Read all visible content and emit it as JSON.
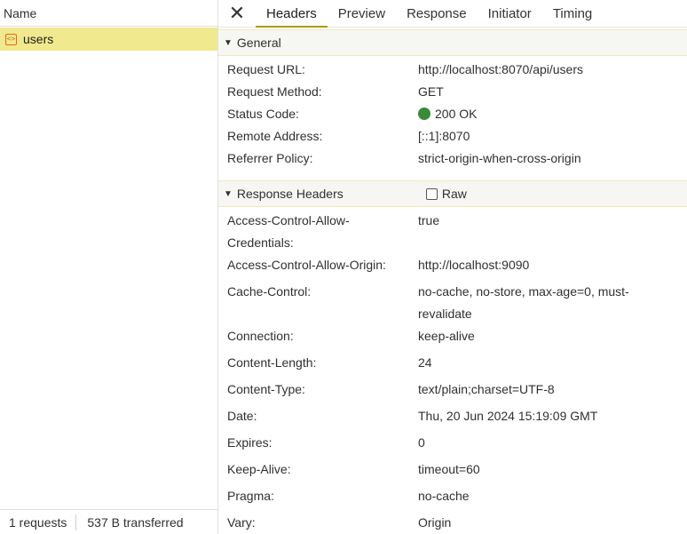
{
  "left": {
    "header": "Name",
    "request": {
      "name": "users",
      "icon": "xhr-icon"
    },
    "footer": {
      "requests": "1 requests",
      "transferred": "537 B transferred"
    }
  },
  "tabs": [
    "Headers",
    "Preview",
    "Response",
    "Initiator",
    "Timing"
  ],
  "close_icon": "close-icon",
  "general": {
    "title": "General",
    "rows": [
      {
        "key": "Request URL:",
        "value": "http://localhost:8070/api/users"
      },
      {
        "key": "Request Method:",
        "value": "GET"
      },
      {
        "key": "Status Code:",
        "value": "200 OK"
      },
      {
        "key": "Remote Address:",
        "value": "[::1]:8070"
      },
      {
        "key": "Referrer Policy:",
        "value": "strict-origin-when-cross-origin"
      }
    ],
    "status_color": "#3a8a3a"
  },
  "response_headers": {
    "title": "Response Headers",
    "raw_label": "Raw",
    "rows": [
      {
        "key1": "Access-Control-Allow-",
        "key2": "Credentials:",
        "value": "true"
      },
      {
        "key": "Access-Control-Allow-Origin:",
        "value": "http://localhost:9090"
      },
      {
        "key": "Cache-Control:",
        "value1": "no-cache, no-store, max-age=0, must-",
        "value2": "revalidate"
      },
      {
        "key": "Connection:",
        "value": "keep-alive"
      },
      {
        "key": "Content-Length:",
        "value": "24"
      },
      {
        "key": "Content-Type:",
        "value": "text/plain;charset=UTF-8"
      },
      {
        "key": "Date:",
        "value": "Thu, 20 Jun 2024 15:19:09 GMT"
      },
      {
        "key": "Expires:",
        "value": "0"
      },
      {
        "key": "Keep-Alive:",
        "value": "timeout=60"
      },
      {
        "key": "Pragma:",
        "value": "no-cache"
      },
      {
        "key": "Vary:",
        "value": "Origin"
      }
    ]
  },
  "colors": {
    "selected_row": "#f1e98d",
    "active_tab_underline": "#a99a17"
  }
}
